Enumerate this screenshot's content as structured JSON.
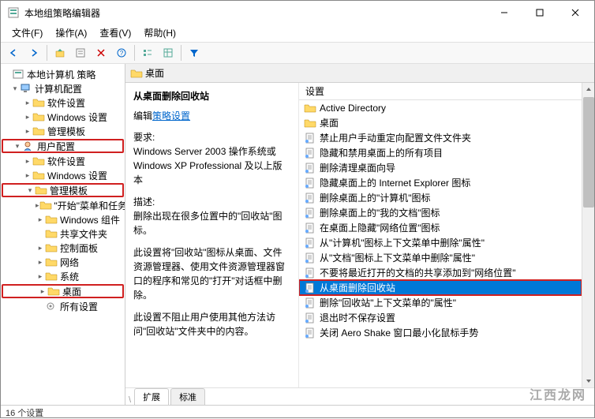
{
  "window": {
    "title": "本地组策略编辑器"
  },
  "menu": {
    "file": "文件(F)",
    "action": "操作(A)",
    "view": "查看(V)",
    "help": "帮助(H)"
  },
  "tree": {
    "root": "本地计算机 策略",
    "computer_config": "计算机配置",
    "cc_software": "软件设置",
    "cc_windows": "Windows 设置",
    "cc_admin": "管理模板",
    "user_config": "用户配置",
    "uc_software": "软件设置",
    "uc_windows": "Windows 设置",
    "uc_admin": "管理模板",
    "start_menu": "\"开始\"菜单和任务栏",
    "windows_comp": "Windows 组件",
    "shared_folders": "共享文件夹",
    "control_panel": "控制面板",
    "network": "网络",
    "system": "系统",
    "desktop": "桌面",
    "all_settings": "所有设置"
  },
  "detail": {
    "header": "桌面",
    "selected_title": "从桌面删除回收站",
    "edit_label": "编辑",
    "policy_link": "策略设置",
    "req_label": "要求:",
    "req_text": "Windows Server 2003 操作系统或 Windows XP Professional 及以上版本",
    "desc_label": "描述:",
    "desc_text": "删除出现在很多位置中的\"回收站\"图标。",
    "desc_para2": "此设置将\"回收站\"图标从桌面、文件资源管理器、使用文件资源管理器窗口的程序和常见的\"打开\"对话框中删除。",
    "desc_para3": "此设置不阻止用户使用其他方法访问\"回收站\"文件夹中的内容。"
  },
  "settings": {
    "col_header": "设置",
    "items": [
      "Active Directory",
      "桌面",
      "禁止用户手动重定向配置文件文件夹",
      "隐藏和禁用桌面上的所有项目",
      "删除清理桌面向导",
      "隐藏桌面上的 Internet Explorer 图标",
      "删除桌面上的\"计算机\"图标",
      "删除桌面上的\"我的文档\"图标",
      "在桌面上隐藏\"网络位置\"图标",
      "从\"计算机\"图标上下文菜单中删除\"属性\"",
      "从\"文档\"图标上下文菜单中删除\"属性\"",
      "不要将最近打开的文档的共享添加到\"网络位置\"",
      "从桌面删除回收站",
      "删除\"回收站\"上下文菜单的\"属性\"",
      "退出时不保存设置",
      "关闭 Aero Shake 窗口最小化鼠标手势"
    ],
    "selected_index": 12
  },
  "tabs": {
    "extended": "扩展",
    "standard": "标准"
  },
  "status": {
    "count": "16 个设置"
  },
  "watermark": "江西龙网"
}
